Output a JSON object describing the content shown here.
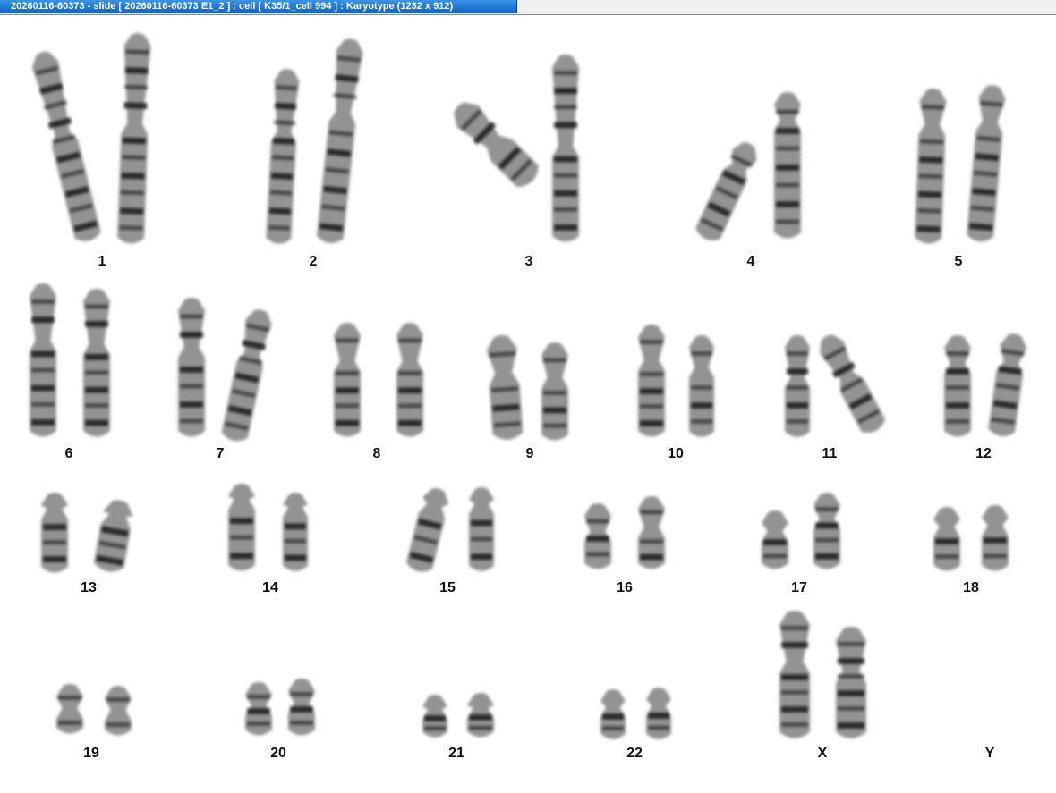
{
  "window": {
    "title": "20260116-60373 - slide [ 20260116-60373 E1_2 ] : cell [ K35/1_cell 994 ] : Karyotype  (1232 x 912)"
  },
  "colors": {
    "title_bar": "#1f78d6",
    "chromosome": "#3a3a3a",
    "band_dark": "#111111"
  },
  "karyotype": {
    "labels": [
      "1",
      "2",
      "3",
      "4",
      "5",
      "6",
      "7",
      "8",
      "9",
      "10",
      "11",
      "12",
      "13",
      "14",
      "15",
      "16",
      "17",
      "18",
      "19",
      "20",
      "21",
      "22",
      "X",
      "Y"
    ]
  }
}
